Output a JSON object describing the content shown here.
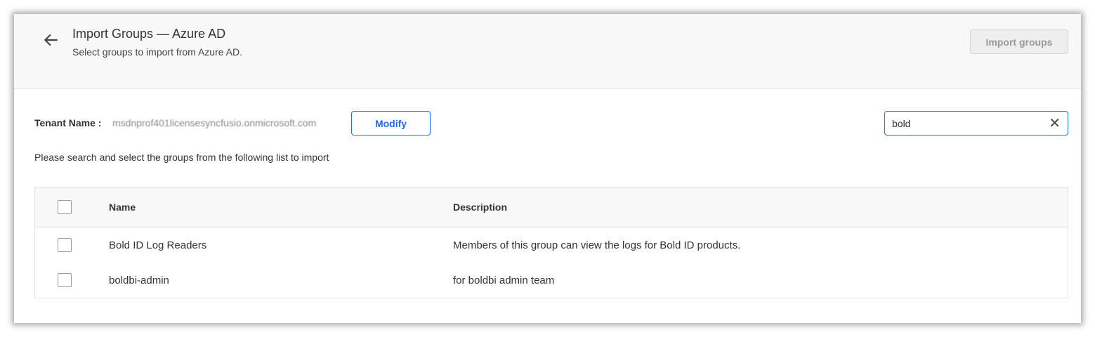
{
  "header": {
    "title": "Import Groups — Azure AD",
    "subtitle": "Select groups to import from Azure AD.",
    "import_button": "Import groups"
  },
  "tenant": {
    "label": "Tenant Name :",
    "value": "msdnprof401licensesyncfusio.onmicrosoft.com",
    "modify_button": "Modify"
  },
  "search": {
    "value": "bold"
  },
  "hint": "Please search and select the groups from the following list to import",
  "table": {
    "columns": [
      "Name",
      "Description"
    ],
    "rows": [
      {
        "name": "Bold ID Log Readers",
        "description": "Members of this group can view the logs for Bold ID products."
      },
      {
        "name": "boldbi-admin",
        "description": "for boldbi admin team"
      }
    ]
  }
}
